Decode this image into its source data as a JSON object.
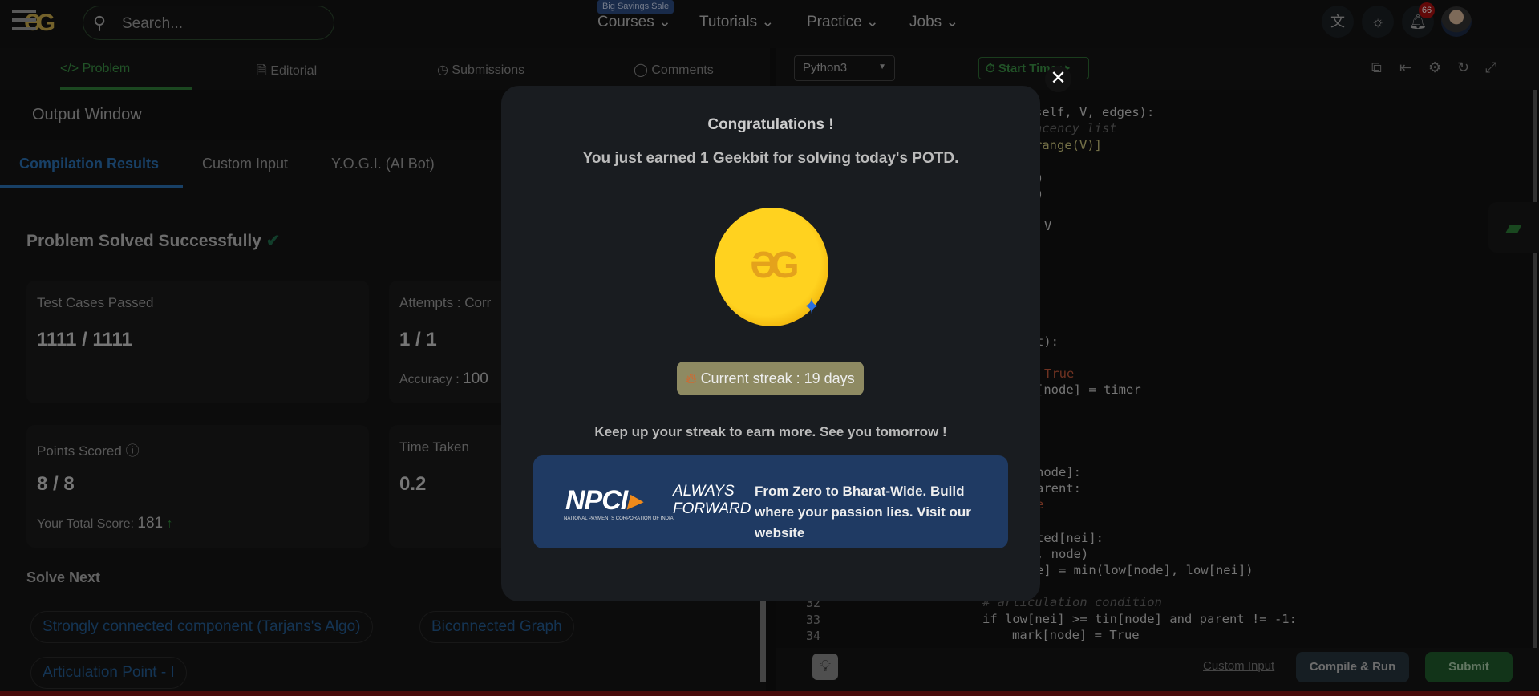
{
  "header": {
    "search_placeholder": "Search...",
    "sale_badge": "Big Savings Sale",
    "nav": [
      "Courses",
      "Tutorials",
      "Practice",
      "Jobs"
    ],
    "notification_count": "66"
  },
  "problem_tabs": [
    "Problem",
    "Editorial",
    "Submissions",
    "Comments"
  ],
  "editor_toolbar": {
    "language": "Python3",
    "timer": "Start Timer"
  },
  "output": {
    "title": "Output Window",
    "tabs": [
      "Compilation Results",
      "Custom Input",
      "Y.O.G.I. (AI Bot)"
    ],
    "status": "Problem Solved Successfully",
    "cards": [
      {
        "label": "Test Cases Passed",
        "value": "1111 / 1111"
      },
      {
        "label": "Attempts : Corr",
        "value": "1 / 1",
        "sub_label": "Accuracy :",
        "sub_value": "100"
      },
      {
        "label": "Points Scored",
        "value": "8 / 8",
        "sub_label": "Your Total Score:",
        "sub_value": "181"
      },
      {
        "label": "Time Taken",
        "value": "0.2"
      }
    ],
    "solve_next": "Solve Next",
    "suggestions": [
      "Strongly connected component (Tarjans's Algo)",
      "Biconnected Graph",
      "Articulation Point - I"
    ]
  },
  "code_fragments": [
    "self, V, edges):",
    "acency list",
    "range(V)]",
    ")",
    ")",
    "V",
    "t):",
    "True",
    "[node] = timer",
    "node]:",
    "arent:",
    "e",
    "ted[nei]:",
    ", node)",
    "e] = min(low[node], low[nei])"
  ],
  "code_lines": [
    {
      "n": "32",
      "text": "# articulation condition"
    },
    {
      "n": "33",
      "text": "if low[nei] >= tin[node] and parent != -1:"
    },
    {
      "n": "34",
      "text": "mark[node] = True"
    }
  ],
  "editor_bottom": {
    "custom_input": "Custom Input",
    "compile": "Compile & Run",
    "submit": "Submit"
  },
  "modal": {
    "title": "Congratulations !",
    "subtitle": "You just earned 1 Geekbit for solving today's POTD.",
    "streak": "Current streak : 19 days",
    "keep": "Keep up your streak to earn more. See you tomorrow !",
    "banner": {
      "logo": "NPCI",
      "logo_sub": "NATIONAL PAYMENTS CORPORATION OF INDIA",
      "tagline_1": "ALWAYS",
      "tagline_2": "FORWARD",
      "text": "From Zero to Bharat-Wide. Build where your passion lies. Visit our website"
    }
  },
  "colors": {
    "accent_green": "#2f8d3a",
    "accent_blue": "#2a6fb0",
    "modal_bg": "#191c20",
    "banner_bg": "#1f3a63",
    "streak_bg": "#8e8a62"
  }
}
